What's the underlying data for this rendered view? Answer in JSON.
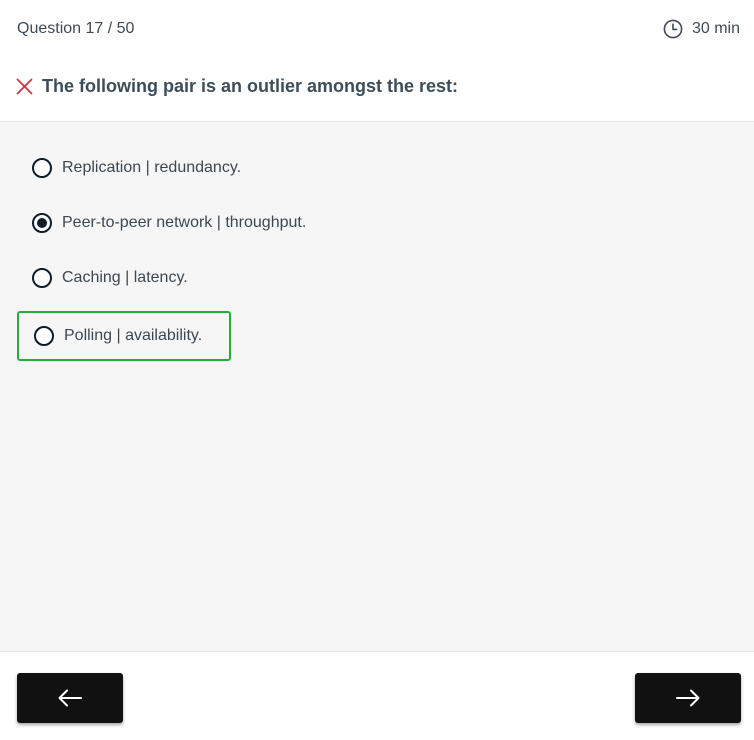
{
  "header": {
    "question_counter": "Question 17 / 50",
    "timer_icon": "clock-icon",
    "timer_label": "30 min",
    "status_icon": "close-x-icon",
    "status_color": "#d0343f",
    "question": "The following pair is an outlier amongst the rest:"
  },
  "options": [
    {
      "label": "Replication | redundancy.",
      "selected": false,
      "correct": false
    },
    {
      "label": "Peer-to-peer network | throughput.",
      "selected": true,
      "correct": false
    },
    {
      "label": "Caching | latency.",
      "selected": false,
      "correct": false
    },
    {
      "label": "Polling | availability.",
      "selected": false,
      "correct": true
    }
  ],
  "colors": {
    "correct_border": "#2bab3a",
    "button_bg": "#111111"
  },
  "footer": {
    "prev_icon": "arrow-left-icon",
    "next_icon": "arrow-right-icon"
  }
}
